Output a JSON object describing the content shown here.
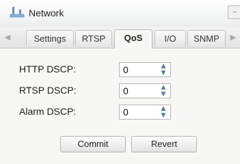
{
  "window": {
    "title": "Network",
    "minimize_label": "–"
  },
  "tabs": [
    {
      "label": "Settings"
    },
    {
      "label": "RTSP"
    },
    {
      "label": "QoS",
      "active": true
    },
    {
      "label": "I/O"
    },
    {
      "label": "SNMP"
    }
  ],
  "form": {
    "rows": [
      {
        "label": "HTTP DSCP:",
        "value": "0"
      },
      {
        "label": "RTSP DSCP:",
        "value": "0"
      },
      {
        "label": "Alarm DSCP:",
        "value": "0"
      }
    ]
  },
  "actions": {
    "commit_label": "Commit",
    "revert_label": "Revert"
  },
  "icons": {
    "title": "network-icon",
    "tab_prev": "arrow-left-icon",
    "tab_next": "arrow-right-icon",
    "spin_up": "chevron-up-icon",
    "spin_down": "chevron-down-icon"
  },
  "colors": {
    "accent": "#5b78a8"
  }
}
